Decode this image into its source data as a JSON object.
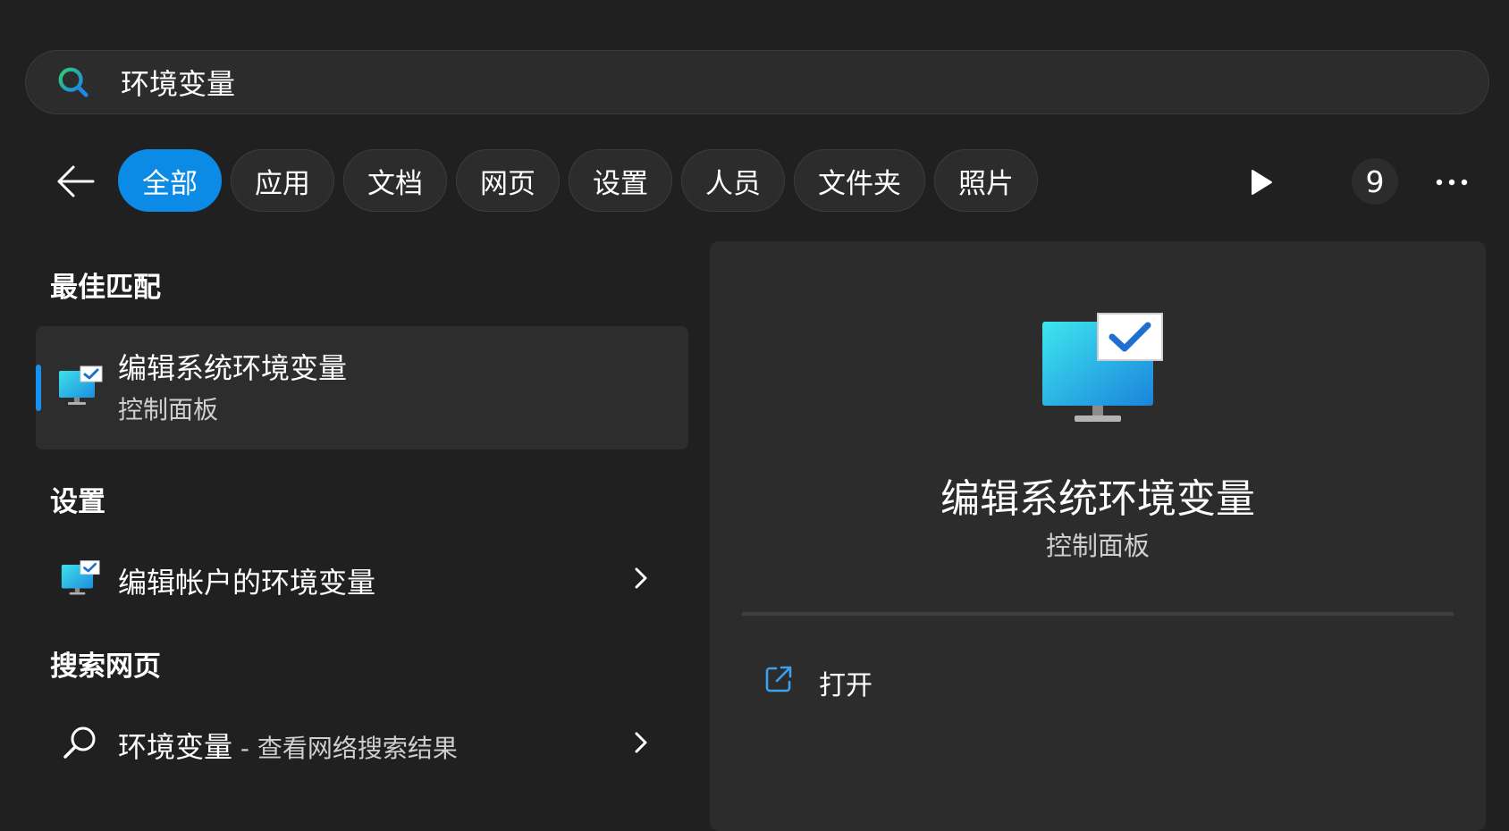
{
  "search": {
    "query": "环境变量"
  },
  "filters": {
    "tabs": [
      {
        "label": "全部",
        "active": true
      },
      {
        "label": "应用"
      },
      {
        "label": "文档"
      },
      {
        "label": "网页"
      },
      {
        "label": "设置"
      },
      {
        "label": "人员"
      },
      {
        "label": "文件夹"
      },
      {
        "label": "照片"
      }
    ],
    "count": "9"
  },
  "best_match": {
    "header": "最佳匹配",
    "title": "编辑系统环境变量",
    "subtitle": "控制面板",
    "icon": "monitor-check-icon"
  },
  "settings": {
    "header": "设置",
    "items": [
      {
        "label": "编辑帐户的环境变量",
        "icon": "monitor-check-icon"
      }
    ]
  },
  "web": {
    "header": "搜索网页",
    "items": [
      {
        "query": "环境变量",
        "suffix": " - 查看网络搜索结果",
        "icon": "search-icon"
      }
    ]
  },
  "detail": {
    "title": "编辑系统环境变量",
    "subtitle": "控制面板",
    "actions": [
      {
        "label": "打开",
        "icon": "open-external-icon"
      }
    ]
  },
  "colors": {
    "accent": "#0b8ae6",
    "background": "#202020",
    "panel": "#2c2c2c"
  }
}
